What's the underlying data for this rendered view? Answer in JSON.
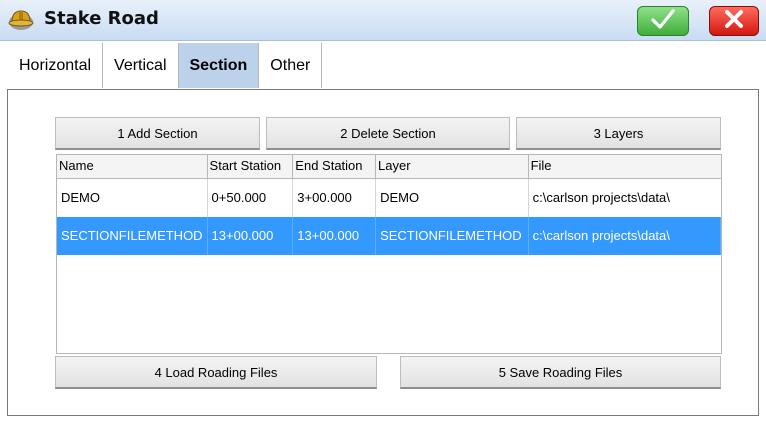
{
  "title": "Stake Road",
  "tabs": [
    "Horizontal",
    "Vertical",
    "Section",
    "Other"
  ],
  "active_tab": "Section",
  "buttons": {
    "add_section": "1 Add Section",
    "delete_section": "2 Delete Section",
    "layers": "3 Layers",
    "load_roading": "4 Load Roading Files",
    "save_roading": "5 Save Roading Files"
  },
  "table": {
    "columns": [
      "Name",
      "Start Station",
      "End Station",
      "Layer",
      "File"
    ],
    "rows": [
      [
        "DEMO",
        "0+50.000",
        "3+00.000",
        "DEMO",
        "c:\\carlson projects\\data\\"
      ],
      [
        "SECTIONFILEMETHOD",
        "13+00.000",
        "13+00.000",
        "SECTIONFILEMETHOD",
        "c:\\carlson projects\\data\\"
      ]
    ],
    "selected_row": 1
  },
  "colors": {
    "selection": "#3399ff",
    "active_tab": "#bcd2ea",
    "ok": "#3fae3a",
    "close": "#d3170f"
  }
}
